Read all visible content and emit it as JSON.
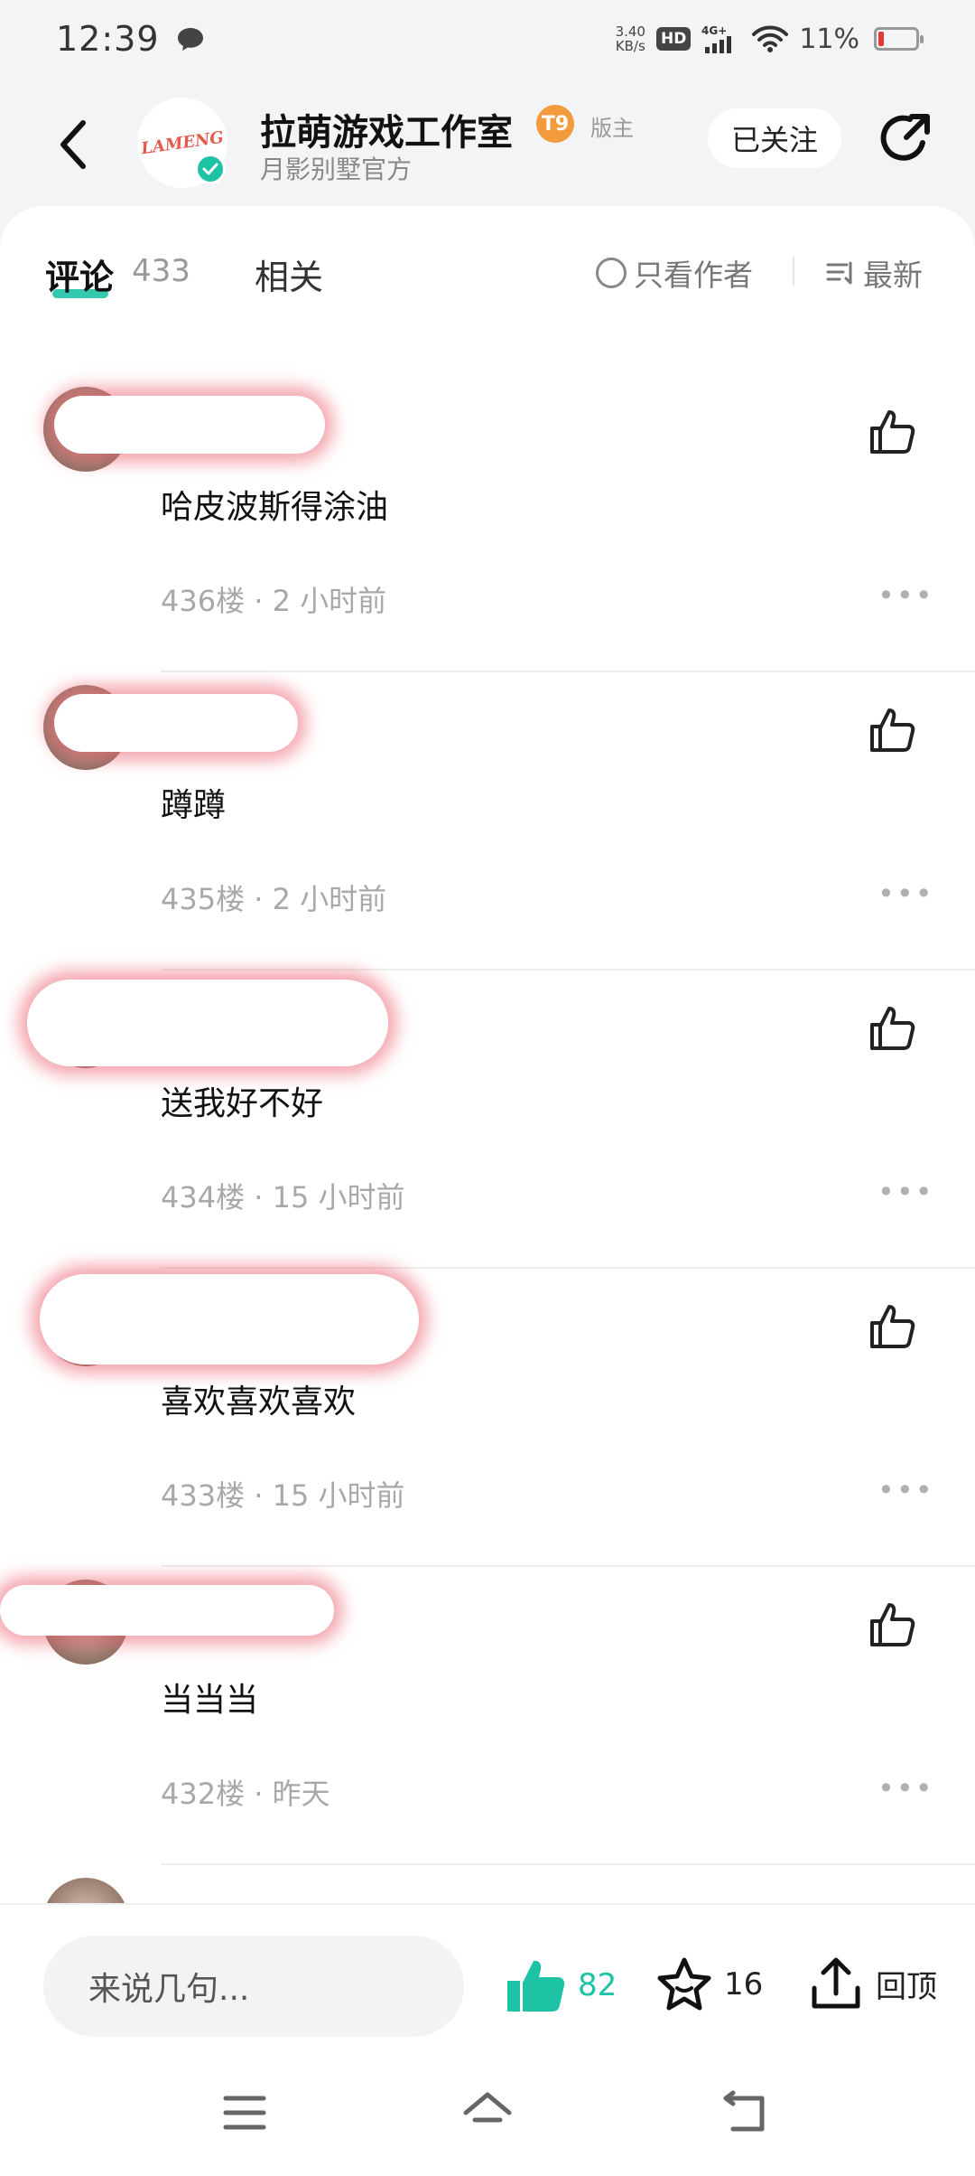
{
  "status_bar": {
    "time": "12:39",
    "net_speed": "3.40\nKB/s",
    "hd": "HD",
    "signal": "4G+",
    "battery": "11%"
  },
  "header": {
    "title": "拉萌游戏工作室",
    "level": "T9",
    "mod_tag": "版主",
    "subtitle": "月影别墅官方",
    "logo_text": "LAMENG",
    "follow_label": "已关注"
  },
  "tabs": {
    "comment_label": "评论",
    "comment_count": "433",
    "related_label": "相关",
    "author_only_label": "只看作者",
    "sort_label": "最新"
  },
  "comments": [
    {
      "text": "哈皮波斯得涂油",
      "floor": "436楼",
      "time": "2 小时前"
    },
    {
      "text": "蹲蹲",
      "floor": "435楼",
      "time": "2 小时前"
    },
    {
      "text": "送我好不好",
      "floor": "434楼",
      "time": "15 小时前"
    },
    {
      "text": "喜欢喜欢喜欢",
      "floor": "433楼",
      "time": "15 小时前"
    },
    {
      "text": "当当当",
      "floor": "432楼",
      "time": "昨天"
    }
  ],
  "bottom_bar": {
    "input_placeholder": "来说几句...",
    "like_count": "82",
    "fav_count": "16",
    "top_label": "回顶"
  },
  "colors": {
    "accent": "#1ec3a6",
    "background": "#f3f4f6",
    "level_badge": "#f39a3d"
  }
}
